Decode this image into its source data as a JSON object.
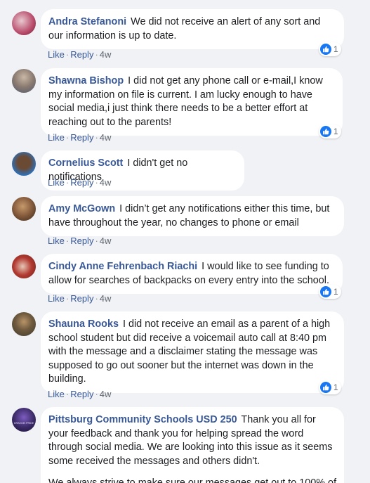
{
  "comments": [
    {
      "author": "Andra Stefanoni",
      "text": "We did not receive an alert of any sort and our information is up to date.",
      "like_label": "Like",
      "reply_label": "Reply",
      "time": "4w",
      "reactions": "1",
      "avatar_colors": [
        "#b84a6a",
        "#e8c9d0"
      ]
    },
    {
      "author": "Shawna Bishop",
      "text": "I did not get any phone call or e-mail,I know my information on file is current. I am lucky enough to have social media,i just think there needs to be a better effort at reaching out to the parents!",
      "like_label": "Like",
      "reply_label": "Reply",
      "time": "4w",
      "reactions": "1",
      "avatar_colors": [
        "#6f7f96",
        "#c9b8a6"
      ]
    },
    {
      "author": "Cornelius Scott",
      "text": "I didn't get no notifications",
      "like_label": "Like",
      "reply_label": "Reply",
      "time": "4w",
      "avatar_colors": [
        "#2f6fb5",
        "#6b4a34"
      ]
    },
    {
      "author": "Amy McGown",
      "text": "I didn’t get any notifications either this time, but have throughout the year, no changes to phone or email",
      "like_label": "Like",
      "reply_label": "Reply",
      "time": "4w",
      "avatar_colors": [
        "#5a3b24",
        "#c79a6b"
      ]
    },
    {
      "author": "Cindy Anne Fehrenbach Riachi",
      "text": "I would like to see funding to allow for searches of backpacks on every entry into the school.",
      "like_label": "Like",
      "reply_label": "Reply",
      "time": "4w",
      "reactions": "1",
      "avatar_colors": [
        "#b23a32",
        "#e6c7b6"
      ]
    },
    {
      "author": "Shauna Rooks",
      "text": "I did not receive an email as a parent of a high school student but did receive a voicemail auto call at 8:40 pm with the message and a disclaimer stating the message was supposed to go out sooner but the internet was down in the building.",
      "like_label": "Like",
      "reply_label": "Reply",
      "time": "4w",
      "reactions": "1",
      "avatar_colors": [
        "#3f3a2e",
        "#b89468"
      ]
    },
    {
      "author": "Pittsburg Community Schools USD 250",
      "text": "Thank you all for your feedback and thank you for helping spread the word through social media. We are looking into this issue as it seems some received the messages and others didn't.",
      "text2": "We always strive to make sure our messages get out to 100% of",
      "avatar_text": "DRAGON PRIDE",
      "avatar_colors": [
        "#2a1f4a",
        "#7d5cc0"
      ]
    }
  ],
  "icons": {
    "reaction": "thumbs-up-icon"
  },
  "colors": {
    "link": "#385898",
    "like_blue": "#1877f2",
    "background": "#f0f2f5"
  }
}
